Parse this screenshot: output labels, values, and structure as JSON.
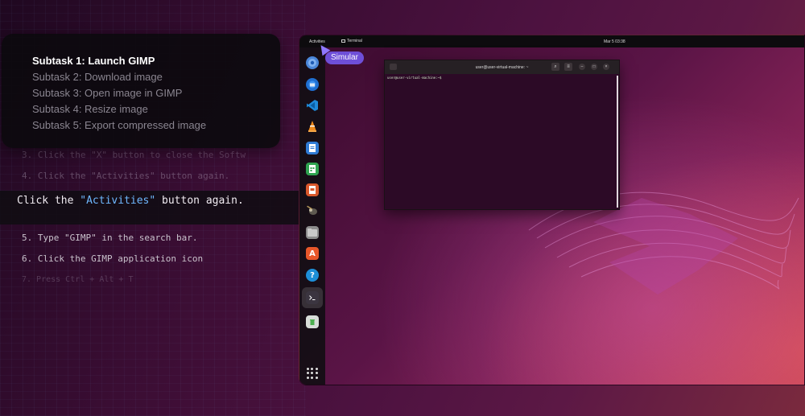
{
  "subtasks": [
    {
      "label": "Subtask 1: Launch GIMP",
      "active": true
    },
    {
      "label": "Subtask 2: Download image",
      "active": false
    },
    {
      "label": "Subtask 3: Open image in GIMP",
      "active": false
    },
    {
      "label": "Subtask 4: Resize image",
      "active": false
    },
    {
      "label": "Subtask 5: Export compressed image",
      "active": false
    }
  ],
  "steps": {
    "step3": "3. Click the \"X\" button to close the Softw",
    "step4": "4. Click the \"Activities\" button again.",
    "current_prefix": "Click the ",
    "current_highlight": "\"Activities\"",
    "current_suffix": " button again.",
    "step5": "5. Type \"GIMP\" in the search bar.",
    "step6": "6. Click the GIMP application icon",
    "step7": "7. Press Ctrl + Alt + T"
  },
  "desktop": {
    "topbar": {
      "activities": "Activities",
      "app_name": "Terminal",
      "clock": "Mar 5 03:38"
    },
    "agent_tag": "Simular",
    "terminal": {
      "title": "user@user-virtual-machine: ~",
      "prompt": "user@user-virtual-machine:~$"
    },
    "dock_icons": [
      "chromium-icon",
      "thunderbird-icon",
      "vscode-icon",
      "vlc-icon",
      "writer-icon",
      "calc-icon",
      "impress-icon",
      "gimp-icon",
      "files-icon",
      "software-icon",
      "help-icon",
      "terminal-icon",
      "trash-icon"
    ]
  }
}
